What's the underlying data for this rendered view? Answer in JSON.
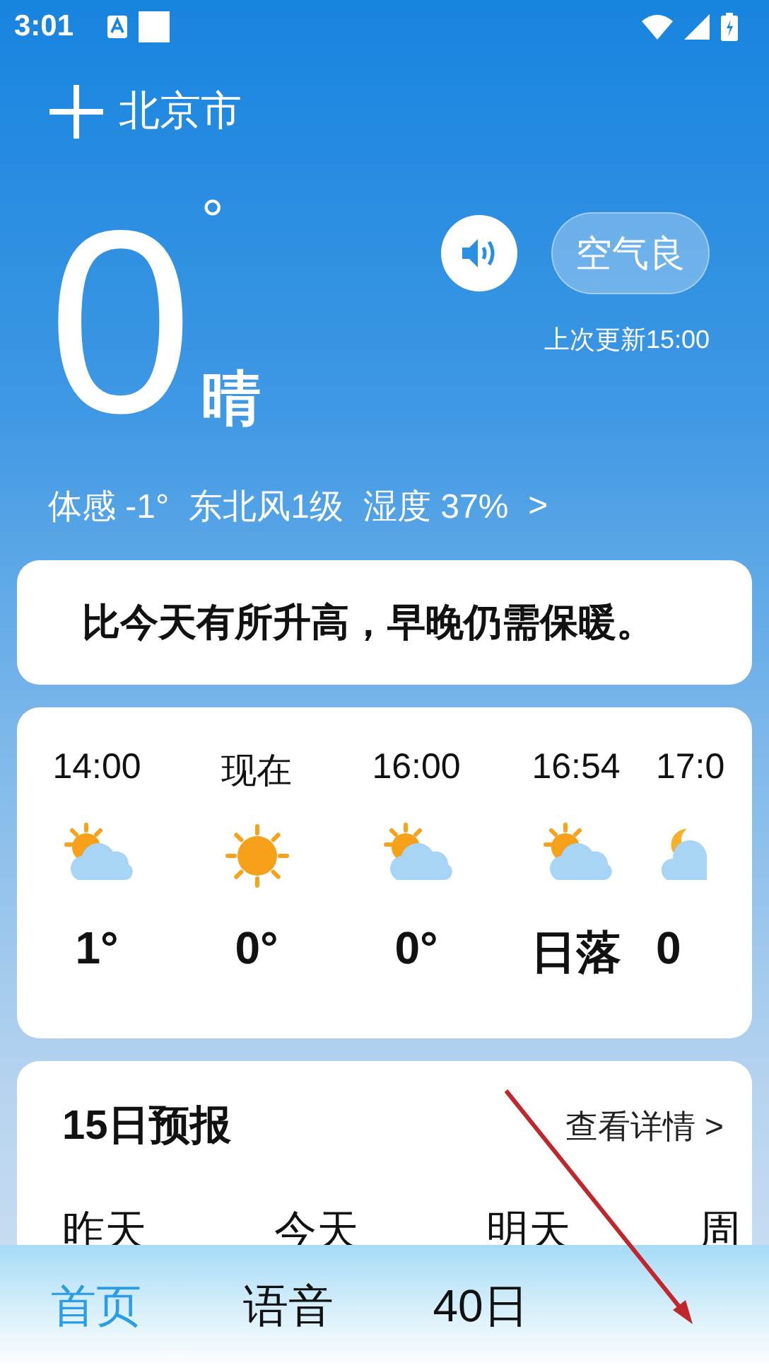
{
  "status_bar": {
    "time": "3:01"
  },
  "location": {
    "city": "北京市"
  },
  "current": {
    "temperature": "0",
    "degree": "°",
    "condition": "晴",
    "air_quality": "空气良",
    "updated": "上次更新15:00",
    "details": [
      "体感 -1°",
      "东北风1级",
      "湿度 37%",
      ">"
    ]
  },
  "tip": {
    "text": "比今天有所升高，早晚仍需保暖。"
  },
  "hourly": [
    {
      "time": "14:00",
      "kind": "partly_cloudy",
      "value": "1°"
    },
    {
      "time": "现在",
      "kind": "sun",
      "value": "0°"
    },
    {
      "time": "16:00",
      "kind": "partly_cloudy",
      "value": "0°"
    },
    {
      "time": "16:54",
      "kind": "partly_cloudy",
      "value": "日落"
    },
    {
      "time": "17:0",
      "kind": "moon_cloudy",
      "value": "0"
    }
  ],
  "forecast": {
    "title": "15日预报",
    "link": "查看详情 >",
    "days": [
      "昨天",
      "今天",
      "明天",
      "周"
    ]
  },
  "tabs": [
    {
      "label": "首页",
      "selected": true
    },
    {
      "label": "语音",
      "selected": false
    },
    {
      "label": "40日",
      "selected": false
    }
  ]
}
